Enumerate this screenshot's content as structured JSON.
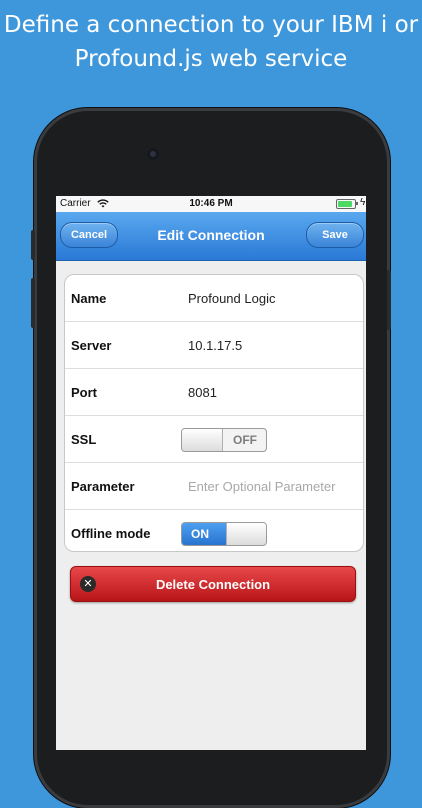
{
  "headline": {
    "line1": "Define a connection to your IBM i or",
    "line2": "Profound.js web service"
  },
  "status_bar": {
    "carrier": "Carrier",
    "time": "10:46 PM"
  },
  "navbar": {
    "title": "Edit Connection",
    "cancel_label": "Cancel",
    "save_label": "Save"
  },
  "form": {
    "rows": [
      {
        "label": "Name",
        "value": "Profound Logic"
      },
      {
        "label": "Server",
        "value": "10.1.17.5"
      },
      {
        "label": "Port",
        "value": "8081"
      },
      {
        "label": "SSL",
        "toggle": "OFF"
      },
      {
        "label": "Parameter",
        "placeholder": "Enter Optional Parameter"
      },
      {
        "label": "Offline mode",
        "toggle": "ON"
      }
    ]
  },
  "delete_button": {
    "label": "Delete Connection",
    "icon": "close-icon"
  },
  "colors": {
    "background": "#3f97db",
    "navbar": "#2a79d6",
    "delete": "#c8191b",
    "toggle_on": "#2874d0"
  }
}
